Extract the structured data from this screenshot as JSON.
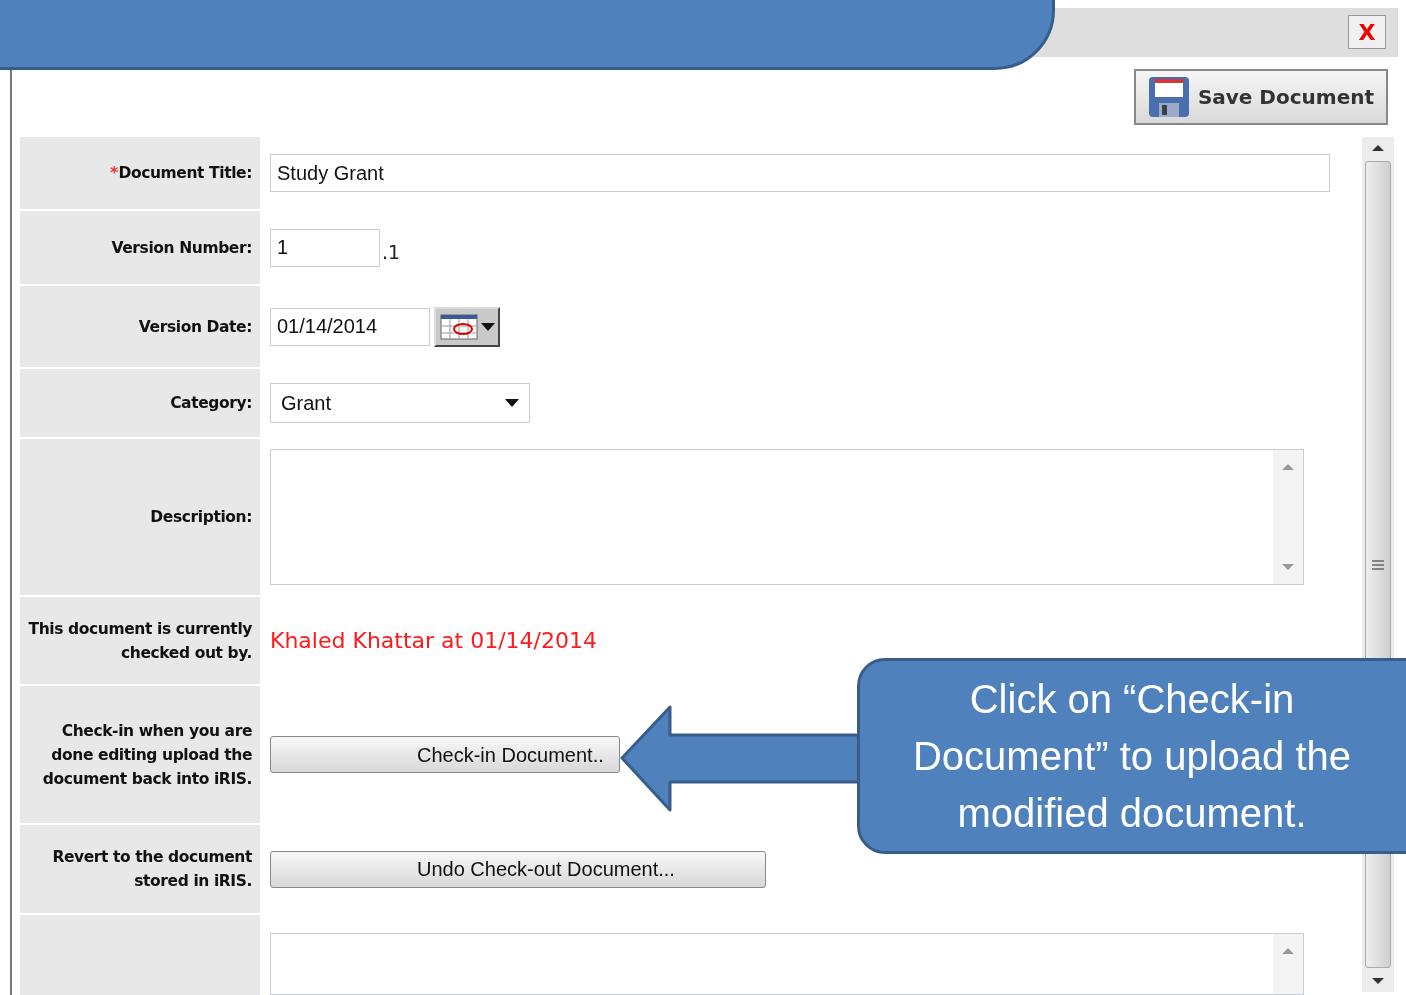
{
  "close_button": {
    "label": "X"
  },
  "save_button": {
    "label": "Save Document"
  },
  "fields": [
    {
      "kind": "text",
      "marker": "*",
      "label": "Document Title:",
      "value": "Study Grant"
    },
    {
      "kind": "version",
      "label": "Version Number:",
      "value": "1",
      "suffix": ".1"
    },
    {
      "kind": "date",
      "label": "Version Date:",
      "value": "01/14/2014"
    },
    {
      "kind": "select",
      "label": "Category:",
      "value": "Grant"
    },
    {
      "kind": "textarea",
      "label": "Description:"
    },
    {
      "kind": "note",
      "label": "This document is currently checked out by.",
      "value": "Khaled Khattar at 01/14/2014"
    },
    {
      "kind": "button",
      "label": "Check-in when you are done editing upload the document back into iRIS.",
      "button": "Check-in Document.."
    },
    {
      "kind": "button",
      "label": "Revert to the document stored in iRIS.",
      "button": "Undo Check-out Document..."
    },
    {
      "kind": "textarea"
    }
  ],
  "callout": {
    "text": "Click on “Check-in Document” to upload the modified document."
  }
}
